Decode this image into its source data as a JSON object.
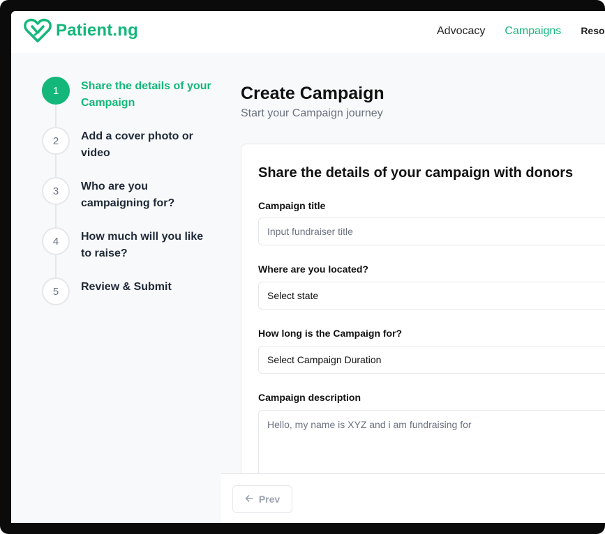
{
  "brand": {
    "name": "Patient.ng",
    "accent": "#14b77a",
    "logo_icon": "heart-logo-icon"
  },
  "nav": {
    "items": [
      {
        "label": "Advocacy",
        "active": false
      },
      {
        "label": "Campaigns",
        "active": true
      },
      {
        "label": "Resou",
        "active": false
      }
    ]
  },
  "steps": [
    {
      "number": "1",
      "label": "Share the details of your Campaign",
      "active": true
    },
    {
      "number": "2",
      "label": "Add a cover photo or video",
      "active": false
    },
    {
      "number": "3",
      "label": "Who are you campaigning for?",
      "active": false
    },
    {
      "number": "4",
      "label": "How much will you like to raise?",
      "active": false
    },
    {
      "number": "5",
      "label": "Review & Submit",
      "active": false
    }
  ],
  "page": {
    "title": "Create Campaign",
    "subtitle": "Start your Campaign journey"
  },
  "form": {
    "heading": "Share the details of your campaign with donors",
    "title_field": {
      "label": "Campaign title",
      "placeholder": "Input fundraiser title"
    },
    "location_field": {
      "label": "Where are you located?",
      "value": "Select state"
    },
    "duration_field": {
      "label": "How long is the Campaign for?",
      "value": "Select Campaign Duration"
    },
    "description_field": {
      "label": "Campaign description",
      "placeholder": "Hello, my name is XYZ and i am fundraising for"
    }
  },
  "footer": {
    "prev_label": "Prev",
    "prev_icon": "arrow-left-icon"
  }
}
